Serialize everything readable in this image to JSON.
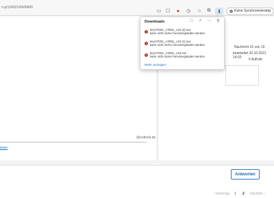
{
  "browser": {
    "url": "n-p/12452149#M495",
    "sync_label": "Keine Synchronisierung",
    "colors": {
      "error": "#c42b1c",
      "link": "#1a73c8",
      "accent": "#1e64b4"
    }
  },
  "downloads": {
    "title": "Downloads",
    "items": [
      {
        "name": "keyVTEDL_v7EDL_v10 (2).exe",
        "status": "kann nicht sicher heruntergeladen werden"
      },
      {
        "name": "keyVTEDL_v7EDL_v10 (1).exe",
        "status": "kann nicht sicher heruntergeladen werden"
      },
      {
        "name": "keyVTEDL_v7EDL_v10.exe",
        "status": "kann nicht sicher heruntergeladen werden"
      }
    ],
    "more_label": "Mehr anzeigen"
  },
  "message": {
    "position_label": "Nachricht 15 von 16",
    "edited_label": "bearbeitet 20.10.2021 14:03",
    "views_label": "6 Aufrufe",
    "email_fragment": "@outlook.de",
    "link_fragment": "ieren"
  },
  "actions": {
    "reply_label": "Antworten"
  },
  "pagination": {
    "prev": "‹ Vorherige",
    "page1": "1",
    "page2": "2",
    "next": "Nächste ›"
  }
}
